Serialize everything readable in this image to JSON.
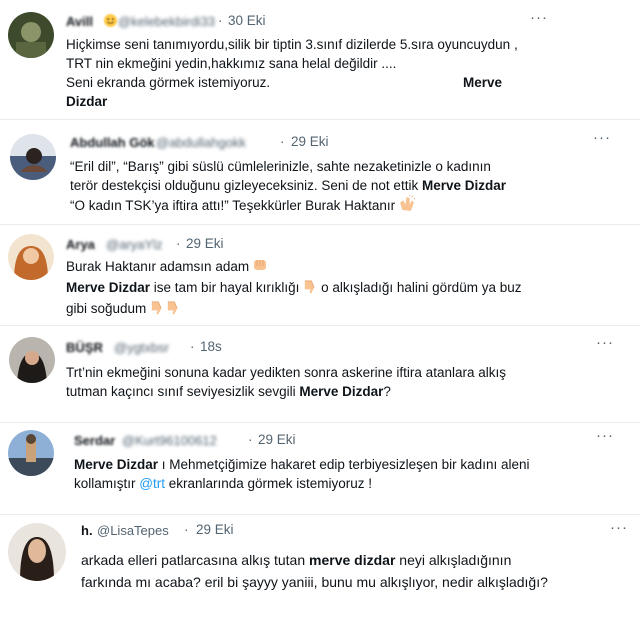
{
  "tweets": [
    {
      "name": "Avill",
      "handle": "@kelebekbirdi33",
      "dot": "·",
      "time": "30 Eki",
      "more": "···",
      "lines": [
        "Hiçkimse seni tanımıyordu,silik bir tiptin 3.sınıf dizilerde 5.sıra oyuncuydun ,",
        "TRT nin ekmeğini yedin,hakkımız sana helal değildir ....",
        "Seni ekranda görmek istemiyoruz."
      ],
      "bold1": "Merve",
      "bold2": "Dizdar"
    },
    {
      "name": "Abdullah Gök",
      "handle": "@abdullahgokk",
      "dot": "·",
      "time": "29 Eki",
      "more": "···",
      "line1": "“Eril dil”, “Barış” gibi süslü cümlelerinizle, sahte nezaketinizle o kadının",
      "line2a": "terör destekçisi olduğunu gizleyeceksiniz. Seni de not ettik ",
      "line2b": "Merve Dizdar",
      "line3": "“O kadın TSK’ya iftira attı!” Teşekkürler Burak Haktanır"
    },
    {
      "name": "Arya",
      "handle": "@aryaYlz",
      "dot": "·",
      "time": "29 Eki",
      "line1": "Burak Haktanır adamsın adam",
      "line2a": "Merve Dizdar",
      "line2b": " ise tam bir hayal kırıklığı",
      "line2c": " o alkışladığı halini gördüm ya buz",
      "line3": "gibi soğudum"
    },
    {
      "name": "BÜŞR",
      "handle": "@ygtxbsr",
      "dot": "·",
      "time": "18s",
      "more": "···",
      "line1": "Trt’nin ekmeğini sonuna kadar yedikten sonra askerine iftira atanlara alkış",
      "line2a": "tutman kaçıncı sınıf seviyesizlik sevgili ",
      "line2b": "Merve Dizdar",
      "line2c": "?"
    },
    {
      "name": "Serdar",
      "handle": "@Kurt96100612",
      "dot": "·",
      "time": "29 Eki",
      "more": "···",
      "line1a": "Merve Dizdar",
      "line1b": " ı Mehmetçiğimize hakaret edip terbiyesizleşen bir kadını aleni",
      "line2a": "kollamıştır ",
      "line2b": "@trt",
      "line2c": " ekranlarında görmek istemiyoruz !"
    },
    {
      "name": "h.",
      "handle": "@LisaTepes",
      "dot": "·",
      "time": "29 Eki",
      "more": "···",
      "line1a": "arkada elleri patlarcasına alkış tutan ",
      "line1b": "merve dizdar",
      "line1c": " neyi alkışladığının",
      "line2": "farkında mı acaba? eril bi şayyy yaniii, bunu mu alkışlıyor, nedir alkışladığı?"
    }
  ],
  "icons": {
    "clap": "clapping-hands-icon",
    "thumbsdown": "thumbs-down-icon",
    "fist": "fist-icon",
    "smile": "smiling-face-icon"
  },
  "colors": {
    "text": "#0f1419",
    "secondary": "#536471",
    "link": "#1d9bf0",
    "divider": "#e6ecf0"
  }
}
